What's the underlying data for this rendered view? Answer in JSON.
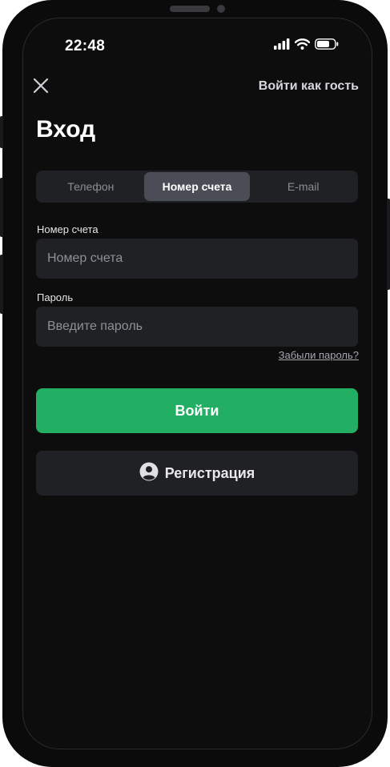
{
  "status_bar": {
    "time": "22:48"
  },
  "header": {
    "guest_label": "Войти как гость",
    "title": "Вход"
  },
  "tabs": [
    {
      "label": "Телефон",
      "active": false
    },
    {
      "label": "Номер счета",
      "active": true
    },
    {
      "label": "E-mail",
      "active": false
    }
  ],
  "form": {
    "account": {
      "label": "Номер счета",
      "placeholder": "Номер счета",
      "value": ""
    },
    "password": {
      "label": "Пароль",
      "placeholder": "Введите пароль",
      "value": ""
    },
    "forgot_label": "Забыли пароль?"
  },
  "actions": {
    "login_label": "Войти",
    "register_label": "Регистрация"
  },
  "icons": {
    "close": "close-icon",
    "register": "user-circle-icon",
    "signal": "signal-icon",
    "wifi": "wifi-icon",
    "battery": "battery-icon"
  },
  "colors": {
    "accent": "#22ae63",
    "background": "#0d0d0e",
    "surface": "#202124",
    "active_tab": "#4a4d55"
  }
}
